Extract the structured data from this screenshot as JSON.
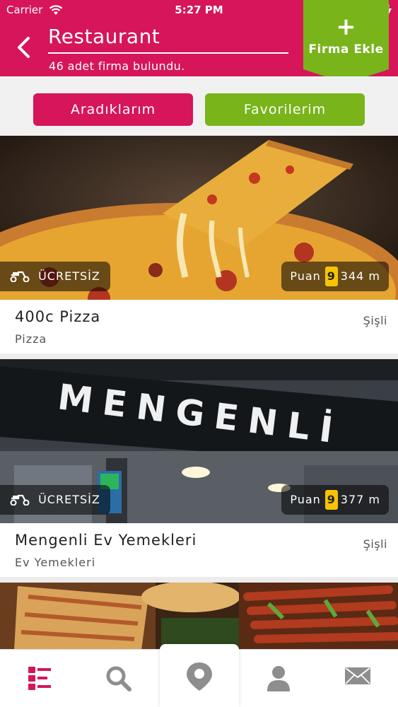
{
  "status_bar": {
    "carrier": "Carrier",
    "time": "5:27 PM",
    "battery_color": "#4cd964"
  },
  "header": {
    "title": "Restaurant",
    "subtitle": "46 adet firma bulundu.",
    "back_icon": "chevron-left-icon",
    "add_button": {
      "icon": "plus-icon",
      "label": "Firma Ekle",
      "color": "#78b41a"
    },
    "color": "#d6155a"
  },
  "filters": {
    "searches_label": "Aradıklarım",
    "favorites_label": "Favorilerim"
  },
  "listings": [
    {
      "name": "400c Pizza",
      "category": "Pizza",
      "district": "Şişli",
      "delivery": "ÜCRETSİZ",
      "score_label": "Puan",
      "score": "9",
      "distance": "344 m",
      "image": "pizza-photo"
    },
    {
      "name": "Mengenli Ev Yemekleri",
      "category": "Ev Yemekleri",
      "district": "Şişli",
      "delivery": "ÜCRETSİZ",
      "score_label": "Puan",
      "score": "9",
      "distance": "377 m",
      "image": "mengenli-storefront-photo",
      "sign_text": "MENGENLİ"
    },
    {
      "image": "pide-kebab-photo"
    }
  ],
  "tab_bar": {
    "items": [
      "list-icon",
      "search-icon",
      "map-pin-icon",
      "user-icon",
      "mail-icon"
    ],
    "active_color": "#d6155a",
    "inactive_color": "#8e8e8e"
  }
}
